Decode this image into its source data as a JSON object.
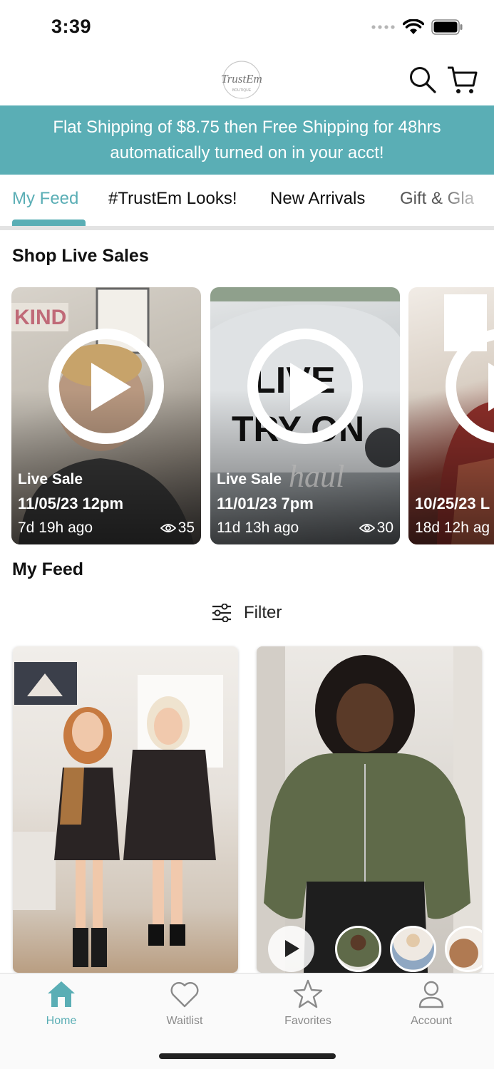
{
  "status_bar": {
    "time": "3:39"
  },
  "header": {
    "logo_text": "TrustEm",
    "icons": [
      "search-icon",
      "cart-icon"
    ]
  },
  "banner": {
    "text": "Flat Shipping of $8.75 then Free Shipping for 48hrs automatically turned on in your acct!"
  },
  "tabs": [
    {
      "label": "My Feed",
      "active": true
    },
    {
      "label": "#TrustEm Looks!",
      "active": false
    },
    {
      "label": "New Arrivals",
      "active": false
    },
    {
      "label": "Gift & Gla",
      "active": false
    }
  ],
  "live_sales": {
    "title": "Shop Live Sales",
    "items": [
      {
        "label": "Live Sale",
        "date": "11/05/23 12pm",
        "ago": "7d 19h ago",
        "views": "35"
      },
      {
        "label": "Live Sale",
        "date": "11/01/23 7pm",
        "ago": "11d 13h ago",
        "views": "30"
      },
      {
        "label": "",
        "date": "10/25/23 L",
        "ago": "18d 12h ag",
        "views": ""
      }
    ]
  },
  "feed": {
    "title": "My Feed",
    "filter_label": "Filter"
  },
  "bottom_nav": [
    {
      "label": "Home",
      "icon": "home-icon",
      "active": true
    },
    {
      "label": "Waitlist",
      "icon": "heart-icon",
      "active": false
    },
    {
      "label": "Favorites",
      "icon": "star-icon",
      "active": false
    },
    {
      "label": "Account",
      "icon": "user-icon",
      "active": false
    }
  ],
  "colors": {
    "accent": "#5aaeb5"
  }
}
